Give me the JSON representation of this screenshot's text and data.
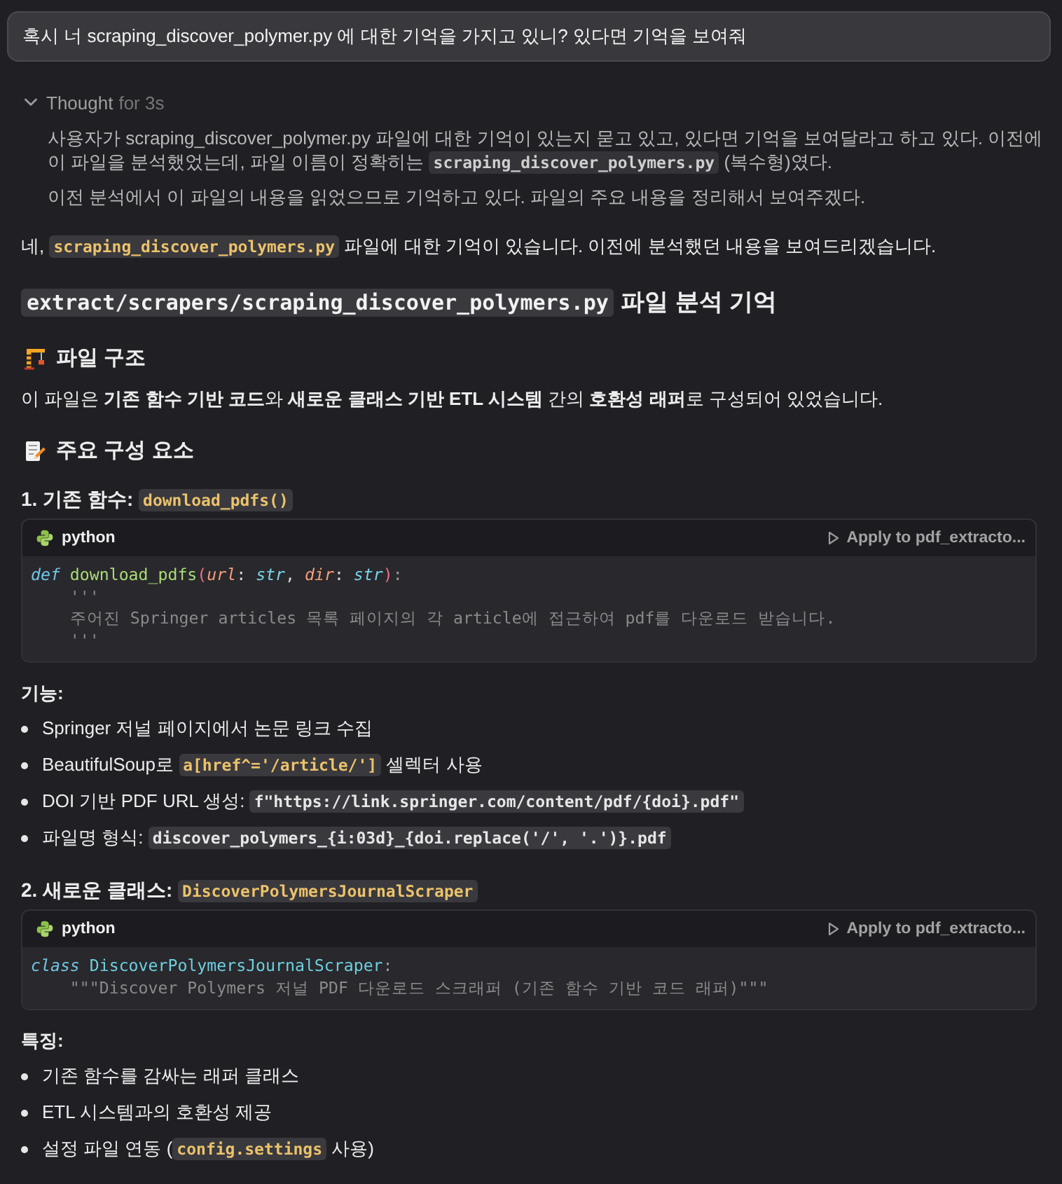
{
  "user_message": {
    "text": "혹시 너 scraping_discover_polymer.py 에 대한 기억을 가지고 있니? 있다면 기억을 보여줘"
  },
  "thought": {
    "label": "Thought",
    "duration": "for 3s",
    "expanded": true,
    "paragraphs": [
      {
        "segments": [
          {
            "kind": "text",
            "text": "사용자가 scraping_discover_polymer.py 파일에 대한 기억이 있는지 묻고 있고, 있다면 기억을 보여달라고 하고 있다. 이전에 이 파일을 분석했었는데, 파일 이름이 정확히는 "
          },
          {
            "kind": "code",
            "text": "scraping_discover_polymers.py",
            "color": "#cfcfcf"
          },
          {
            "kind": "text",
            "text": " (복수형)였다."
          }
        ]
      },
      {
        "segments": [
          {
            "kind": "text",
            "text": "이전 분석에서 이 파일의 내용을 읽었으므로 기억하고 있다. 파일의 주요 내용을 정리해서 보여주겠다."
          }
        ]
      }
    ]
  },
  "response": [
    {
      "kind": "paragraph",
      "segments": [
        {
          "kind": "text",
          "text": "네, "
        },
        {
          "kind": "code",
          "text": "scraping_discover_polymers.py",
          "color": "#ecc36b"
        },
        {
          "kind": "text",
          "text": " 파일에 대한 기억이 있습니다. 이전에 분석했던 내용을 보여드리겠습니다."
        }
      ]
    },
    {
      "kind": "h2",
      "segments": [
        {
          "kind": "code",
          "text": "extract/scrapers/scraping_discover_polymers.py",
          "color": "#f2f2f2"
        },
        {
          "kind": "text",
          "text": " 파일 분석 기억"
        }
      ]
    },
    {
      "kind": "h3",
      "text": "파일 구조"
    },
    {
      "kind": "paragraph",
      "segments": [
        {
          "kind": "text",
          "text": "이 파일은 **기존 함수 기반 코드**와 **새로운 클래스 기반 ETL 시스템** 간의 **호환성 래퍼**로 구성되어 있었습니다."
        }
      ]
    },
    {
      "kind": "h3",
      "text": "주요 구성 요소"
    },
    {
      "kind": "h4",
      "segments": [
        {
          "kind": "text",
          "text": "1. 기존 함수: "
        },
        {
          "kind": "code",
          "text": "download_pdfs()",
          "color": "#ecc36b"
        }
      ]
    },
    {
      "kind": "code_block",
      "language": "python",
      "action": "Apply to pdf_extracto...",
      "lines": [
        [
          {
            "kind": "keyword",
            "text": "def "
          },
          {
            "kind": "function",
            "text": "download_pdfs"
          },
          {
            "kind": "bracket",
            "text": "("
          },
          {
            "kind": "param",
            "text": "url"
          },
          {
            "kind": "plain",
            "text": ": "
          },
          {
            "kind": "type",
            "text": "str"
          },
          {
            "kind": "plain",
            "text": ", "
          },
          {
            "kind": "param",
            "text": "dir"
          },
          {
            "kind": "plain",
            "text": ": "
          },
          {
            "kind": "type",
            "text": "str"
          },
          {
            "kind": "bracket",
            "text": ")"
          },
          {
            "kind": "punct",
            "text": ":"
          }
        ],
        [
          {
            "kind": "string",
            "text": "    '''"
          }
        ],
        [
          {
            "kind": "string",
            "text": "    주어진 Springer articles 목록 페이지의 각 article에 접근하여 pdf를 다운로드 받습니다."
          }
        ],
        [
          {
            "kind": "string",
            "text": "    '''"
          }
        ]
      ]
    },
    {
      "kind": "label",
      "text": "기능:"
    },
    {
      "kind": "list",
      "items": [
        {
          "segments": [
            {
              "kind": "text",
              "text": "Springer 저널 페이지에서 논문 링크 수집"
            }
          ]
        },
        {
          "segments": [
            {
              "kind": "text",
              "text": "BeautifulSoup로 "
            },
            {
              "kind": "code",
              "text": "a[href^='/article/']",
              "color": "#ecc36b"
            },
            {
              "kind": "text",
              "text": " 셀렉터 사용"
            }
          ]
        },
        {
          "segments": [
            {
              "kind": "text",
              "text": "DOI 기반 PDF URL 생성: "
            },
            {
              "kind": "code",
              "text": "f\"https://link.springer.com/content/pdf/{doi}.pdf\"",
              "color": "#e6e6e6"
            }
          ]
        },
        {
          "segments": [
            {
              "kind": "text",
              "text": "파일명 형식: "
            },
            {
              "kind": "code",
              "text": "discover_polymers_{i:03d}_{doi.replace('/', '.')}.pdf",
              "color": "#e6e6e6"
            }
          ]
        }
      ]
    },
    {
      "kind": "h4",
      "segments": [
        {
          "kind": "text",
          "text": "2. 새로운 클래스: "
        },
        {
          "kind": "code",
          "text": "DiscoverPolymersJournalScraper",
          "color": "#ecc36b"
        }
      ]
    },
    {
      "kind": "code_block",
      "language": "python",
      "action": "Apply to pdf_extracto...",
      "lines": [
        [
          {
            "kind": "keyword",
            "text": "class "
          },
          {
            "kind": "class_name",
            "text": "DiscoverPolymersJournalScraper"
          },
          {
            "kind": "punct",
            "text": ":"
          }
        ],
        [
          {
            "kind": "string",
            "text": "    \"\"\"Discover Polymers 저널 PDF 다운로드 스크래퍼 (기존 함수 기반 코드 래퍼)\"\"\""
          }
        ]
      ]
    },
    {
      "kind": "label",
      "text": "특징:"
    },
    {
      "kind": "list",
      "items": [
        {
          "segments": [
            {
              "kind": "text",
              "text": "기존 함수를 감싸는 래퍼 클래스"
            }
          ]
        },
        {
          "segments": [
            {
              "kind": "text",
              "text": "ETL 시스템과의 호환성 제공"
            }
          ]
        },
        {
          "segments": [
            {
              "kind": "text",
              "text": "설정 파일 연동 ("
            },
            {
              "kind": "code",
              "text": "config.settings",
              "color": "#ecc36b"
            },
            {
              "kind": "text",
              "text": " 사용)"
            }
          ]
        }
      ]
    }
  ]
}
